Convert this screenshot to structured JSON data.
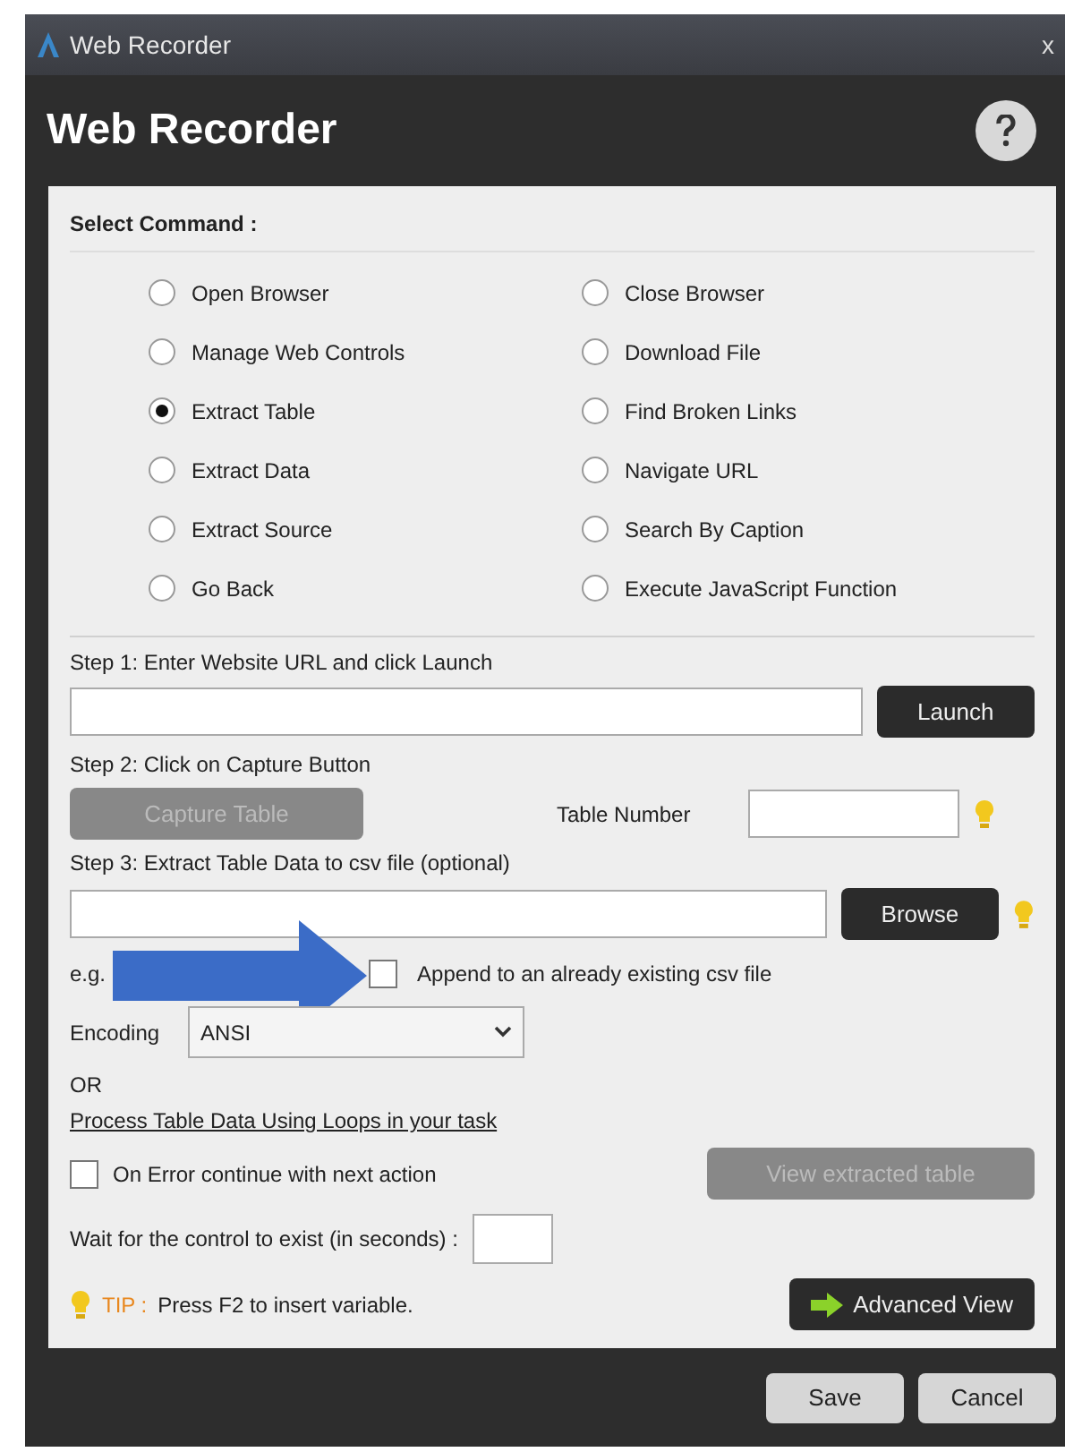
{
  "window": {
    "title": "Web Recorder",
    "close": "x"
  },
  "header": {
    "title": "Web Recorder"
  },
  "command_section": {
    "label": "Select Command :",
    "options": [
      {
        "label": "Open Browser",
        "selected": false
      },
      {
        "label": "Close Browser",
        "selected": false
      },
      {
        "label": "Manage Web Controls",
        "selected": false
      },
      {
        "label": "Download File",
        "selected": false
      },
      {
        "label": "Extract Table",
        "selected": true
      },
      {
        "label": "Find Broken Links",
        "selected": false
      },
      {
        "label": "Extract Data",
        "selected": false
      },
      {
        "label": "Navigate URL",
        "selected": false
      },
      {
        "label": "Extract Source",
        "selected": false
      },
      {
        "label": "Search By Caption",
        "selected": false
      },
      {
        "label": "Go Back",
        "selected": false
      },
      {
        "label": "Execute JavaScript Function",
        "selected": false
      }
    ]
  },
  "step1": {
    "label": "Step 1: Enter Website URL and click Launch",
    "button": "Launch"
  },
  "step2": {
    "label": "Step 2: Click on Capture Button",
    "capture_button": {
      "label": "Capture Table",
      "disabled": true
    },
    "table_number_label": "Table Number"
  },
  "step3": {
    "label": "Step 3: Extract Table Data to csv file (optional)",
    "browse_button": "Browse",
    "example": "e.g.",
    "append_checkbox": {
      "label": "Append to an already existing csv file",
      "checked": false
    },
    "encoding_label": "Encoding",
    "encoding_value": "ANSI",
    "or_label": "OR",
    "loops_link": "Process Table Data Using Loops in your task"
  },
  "on_error": {
    "label": "On Error continue with next action",
    "checked": false
  },
  "view_button": {
    "label": "View extracted table",
    "disabled": true
  },
  "wait": {
    "label": "Wait for the control to exist (in seconds) :"
  },
  "tip": {
    "label": "TIP :",
    "text": "Press F2 to insert variable."
  },
  "advanced_button": "Advanced View",
  "buttons": [
    "Save",
    "Cancel"
  ]
}
